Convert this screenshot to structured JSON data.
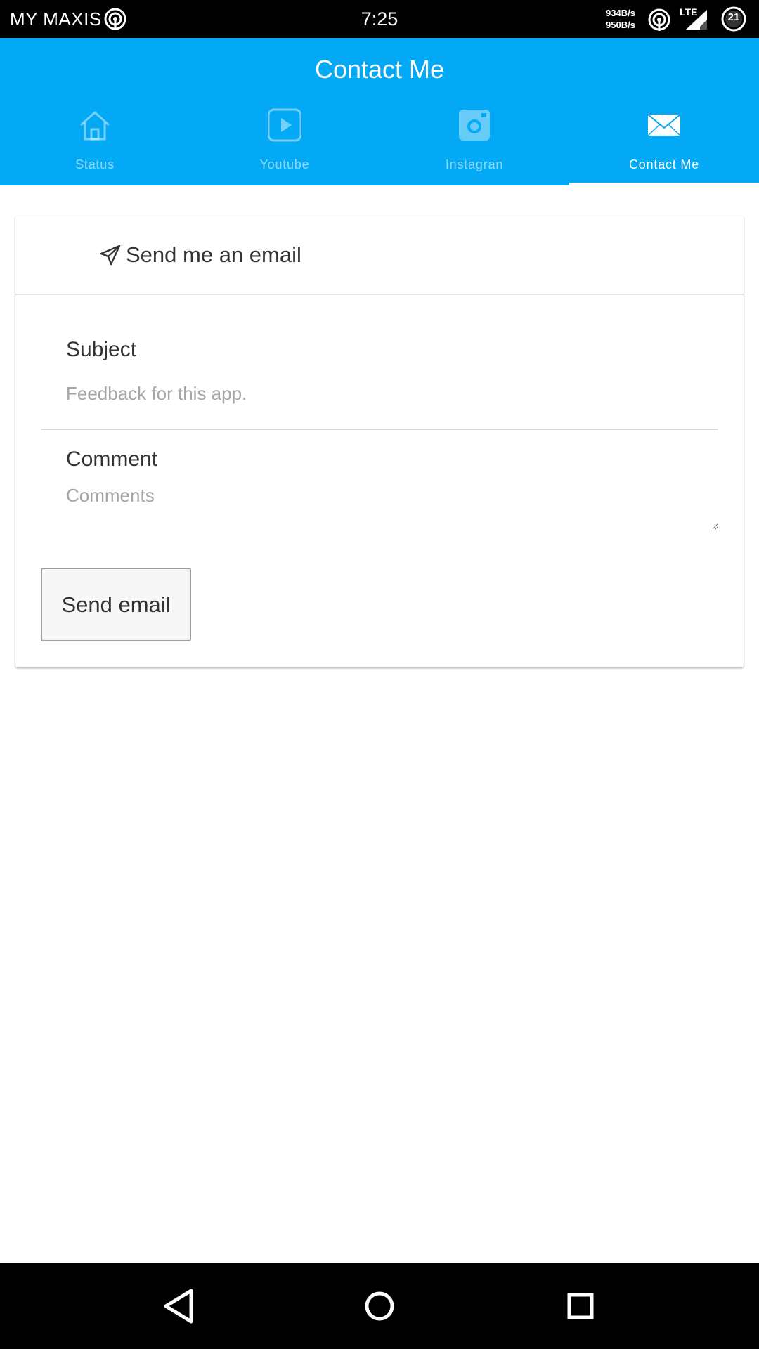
{
  "status_bar": {
    "carrier": "MY MAXIS",
    "time": "7:25",
    "speed_up": "934B/s",
    "speed_down": "950B/s",
    "network": "LTE",
    "battery": "21",
    "icons": [
      "hotspot-icon",
      "signal-icon",
      "battery-icon"
    ]
  },
  "header": {
    "title": "Contact Me",
    "accent_color": "#03a9f4"
  },
  "tabs": [
    {
      "label": "Status",
      "icon": "home-icon",
      "active": false
    },
    {
      "label": "Youtube",
      "icon": "play-icon",
      "active": false
    },
    {
      "label": "Instagran",
      "icon": "camera-icon",
      "active": false
    },
    {
      "label": "Contact Me",
      "icon": "envelope-icon",
      "active": true
    }
  ],
  "card": {
    "title": "Send me an email",
    "title_icon": "paper-plane-icon",
    "subject_label": "Subject",
    "subject_value": "",
    "subject_placeholder": "Feedback for this app.",
    "comment_label": "Comment",
    "comment_value": "",
    "comment_placeholder": "Comments",
    "send_button": "Send email"
  },
  "nav_bar": {
    "buttons": [
      "back-icon",
      "home-icon",
      "recents-icon"
    ]
  }
}
